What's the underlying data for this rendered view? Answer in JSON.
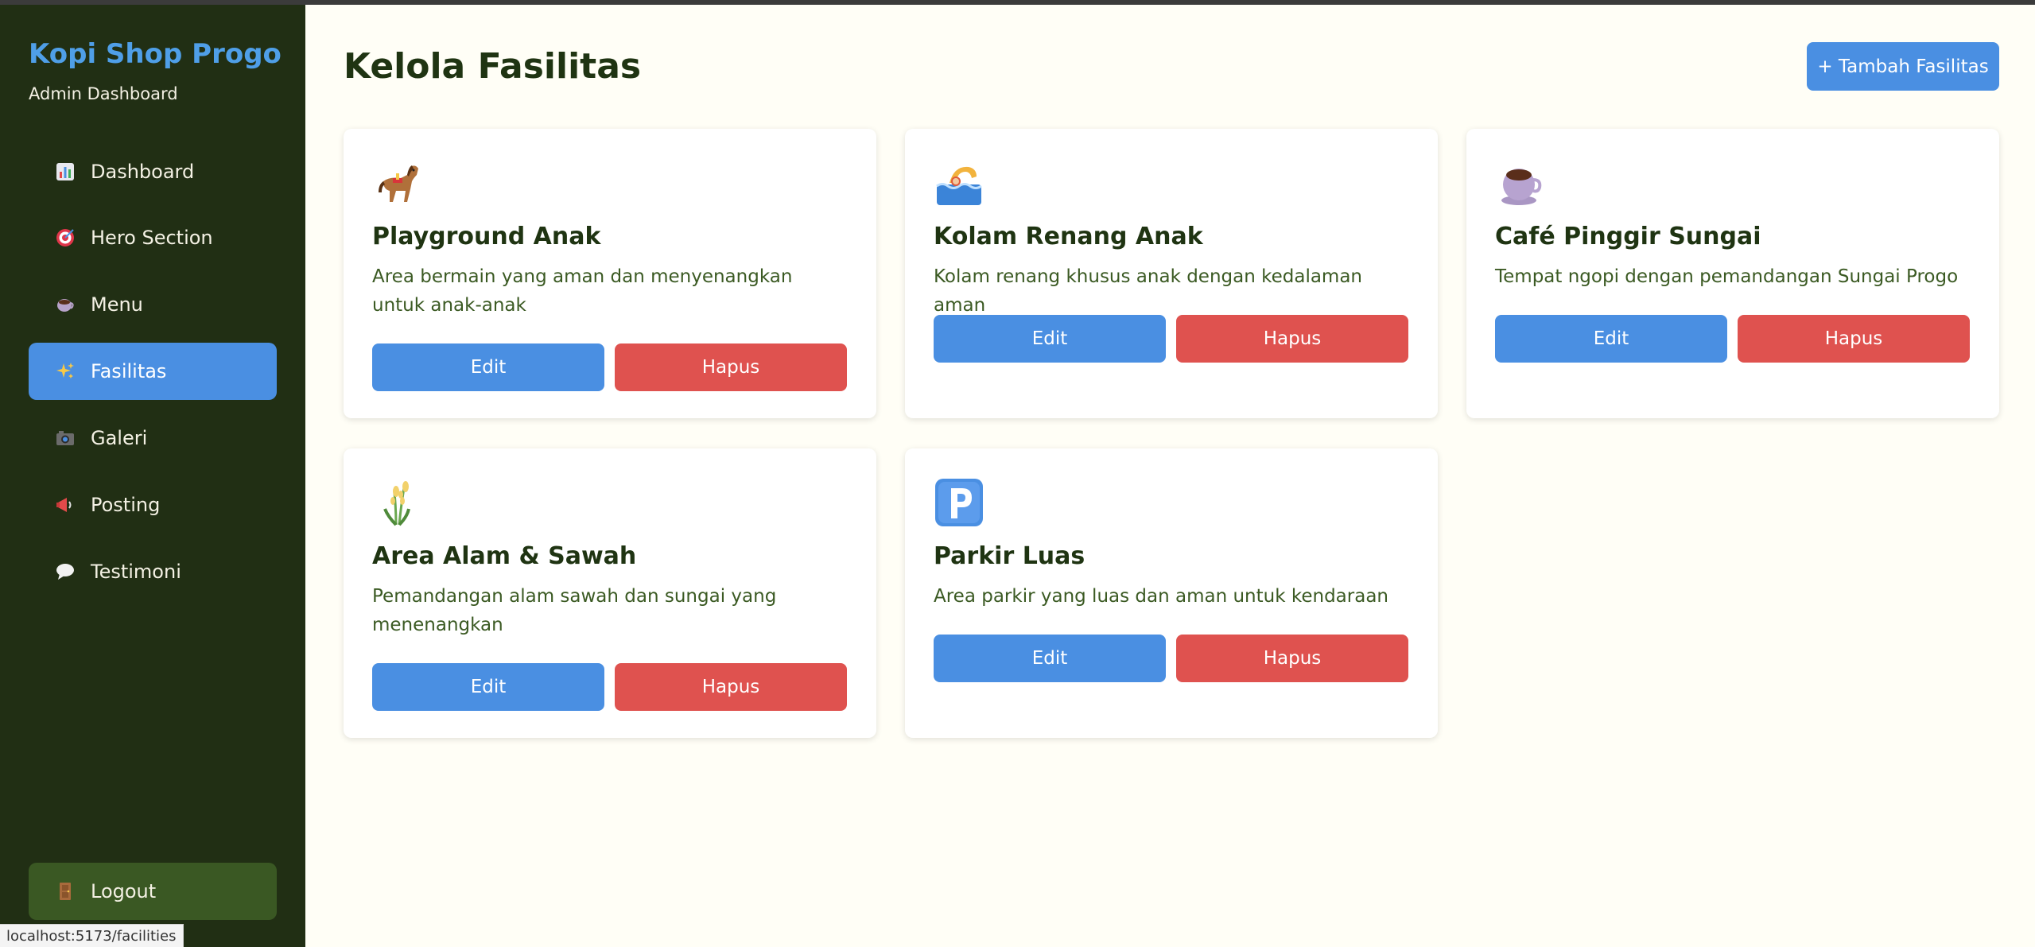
{
  "sidebar": {
    "brand": "Kopi Shop Progo",
    "subtitle": "Admin Dashboard",
    "items": [
      {
        "label": "Dashboard",
        "icon": "bar-chart-icon"
      },
      {
        "label": "Hero Section",
        "icon": "target-icon"
      },
      {
        "label": "Menu",
        "icon": "coffee-cup-icon"
      },
      {
        "label": "Fasilitas",
        "icon": "sparkles-icon",
        "active": true
      },
      {
        "label": "Galeri",
        "icon": "camera-icon"
      },
      {
        "label": "Posting",
        "icon": "megaphone-icon"
      },
      {
        "label": "Testimoni",
        "icon": "speech-bubble-icon"
      }
    ],
    "logout": "Logout"
  },
  "main": {
    "title": "Kelola Fasilitas",
    "add_button": "+ Tambah Fasilitas",
    "facilities": [
      {
        "icon": "horse-icon",
        "name": "Playground Anak",
        "description": "Area bermain yang aman dan menyenangkan untuk anak-anak"
      },
      {
        "icon": "swimmer-icon",
        "name": "Kolam Renang Anak",
        "description": "Kolam renang khusus anak dengan kedalaman aman"
      },
      {
        "icon": "coffee-cup-icon",
        "name": "Café Pinggir Sungai",
        "description": "Tempat ngopi dengan pemandangan Sungai Progo"
      },
      {
        "icon": "rice-plant-icon",
        "name": "Area Alam & Sawah",
        "description": "Pemandangan alam sawah dan sungai yang menenangkan"
      },
      {
        "icon": "parking-icon",
        "name": "Parkir Luas",
        "description": "Area parkir yang luas dan aman untuk kendaraan"
      }
    ],
    "edit_label": "Edit",
    "delete_label": "Hapus"
  },
  "status_bar": {
    "url": "localhost:5173/facilities"
  },
  "colors": {
    "primary": "#4a8fe2",
    "danger": "#df524f",
    "sidebar_bg": "#212f14",
    "heading": "#1f3412"
  }
}
